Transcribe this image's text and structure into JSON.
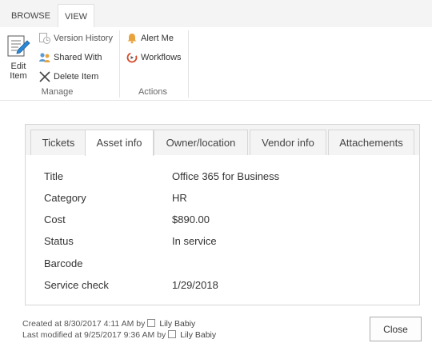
{
  "ribbon": {
    "tabs": [
      {
        "label": "BROWSE"
      },
      {
        "label": "VIEW"
      }
    ],
    "edit_item": {
      "label_line1": "Edit",
      "label_line2": "Item"
    },
    "manage": {
      "version_history": "Version History",
      "shared_with": "Shared With",
      "delete_item": "Delete Item",
      "group_label": "Manage"
    },
    "actions": {
      "alert_me": "Alert Me",
      "workflows": "Workflows",
      "group_label": "Actions"
    }
  },
  "panel": {
    "tabs": [
      "Tickets",
      "Asset info",
      "Owner/location",
      "Vendor info",
      "Attachements"
    ],
    "active_tab": "Asset info",
    "fields": [
      {
        "label": "Title",
        "value": "Office 365 for Business"
      },
      {
        "label": "Category",
        "value": "HR"
      },
      {
        "label": "Cost",
        "value": "$890.00"
      },
      {
        "label": "Status",
        "value": "In service"
      },
      {
        "label": "Barcode",
        "value": ""
      },
      {
        "label": "Service check",
        "value": "1/29/2018"
      }
    ]
  },
  "footer": {
    "created_prefix": "Created at 8/30/2017 4:11 AM by",
    "created_user": "Lily Babiy",
    "modified_prefix": "Last modified at 9/25/2017 9:36 AM by",
    "modified_user": "Lily Babiy",
    "close_label": "Close"
  },
  "colors": {
    "accent_blue": "#2b88d8",
    "alert_orange": "#e8a33c",
    "workflow_red": "#d24726"
  }
}
